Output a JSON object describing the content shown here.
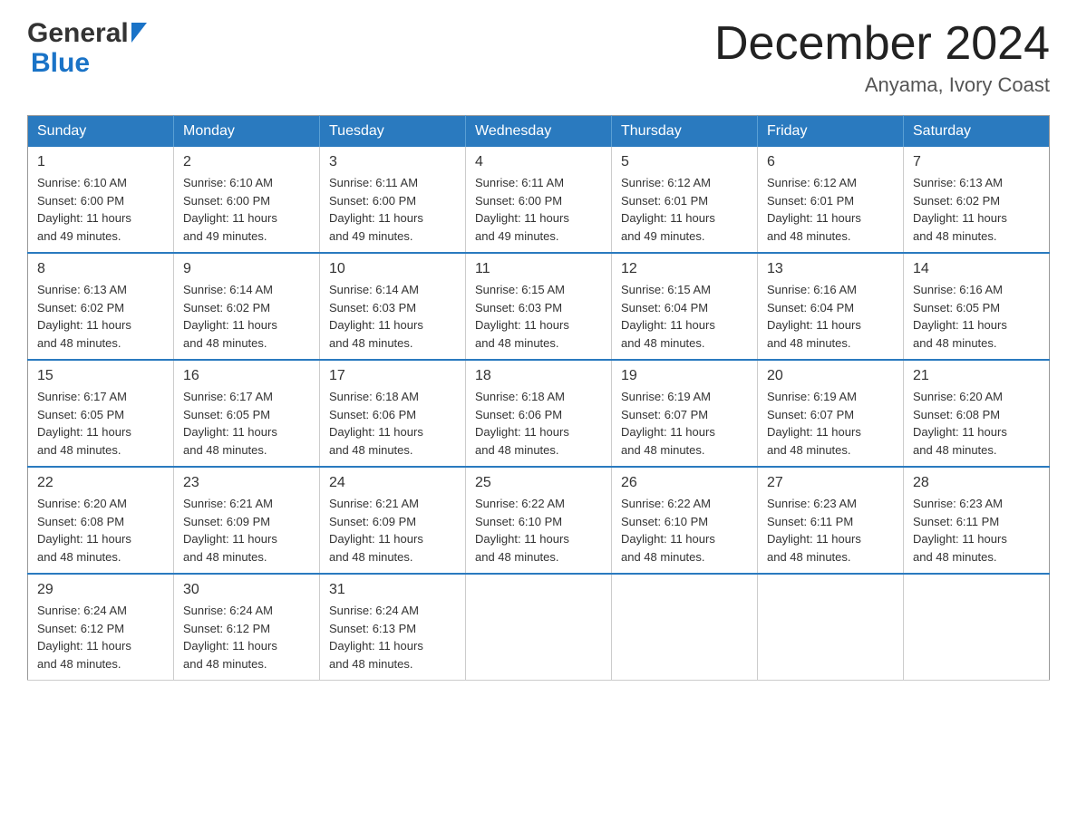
{
  "header": {
    "logo_general": "General",
    "logo_blue": "Blue",
    "month_title": "December 2024",
    "subtitle": "Anyama, Ivory Coast"
  },
  "calendar": {
    "days_of_week": [
      "Sunday",
      "Monday",
      "Tuesday",
      "Wednesday",
      "Thursday",
      "Friday",
      "Saturday"
    ],
    "weeks": [
      [
        {
          "day": "1",
          "sunrise": "6:10 AM",
          "sunset": "6:00 PM",
          "daylight": "11 hours and 49 minutes."
        },
        {
          "day": "2",
          "sunrise": "6:10 AM",
          "sunset": "6:00 PM",
          "daylight": "11 hours and 49 minutes."
        },
        {
          "day": "3",
          "sunrise": "6:11 AM",
          "sunset": "6:00 PM",
          "daylight": "11 hours and 49 minutes."
        },
        {
          "day": "4",
          "sunrise": "6:11 AM",
          "sunset": "6:00 PM",
          "daylight": "11 hours and 49 minutes."
        },
        {
          "day": "5",
          "sunrise": "6:12 AM",
          "sunset": "6:01 PM",
          "daylight": "11 hours and 49 minutes."
        },
        {
          "day": "6",
          "sunrise": "6:12 AM",
          "sunset": "6:01 PM",
          "daylight": "11 hours and 48 minutes."
        },
        {
          "day": "7",
          "sunrise": "6:13 AM",
          "sunset": "6:02 PM",
          "daylight": "11 hours and 48 minutes."
        }
      ],
      [
        {
          "day": "8",
          "sunrise": "6:13 AM",
          "sunset": "6:02 PM",
          "daylight": "11 hours and 48 minutes."
        },
        {
          "day": "9",
          "sunrise": "6:14 AM",
          "sunset": "6:02 PM",
          "daylight": "11 hours and 48 minutes."
        },
        {
          "day": "10",
          "sunrise": "6:14 AM",
          "sunset": "6:03 PM",
          "daylight": "11 hours and 48 minutes."
        },
        {
          "day": "11",
          "sunrise": "6:15 AM",
          "sunset": "6:03 PM",
          "daylight": "11 hours and 48 minutes."
        },
        {
          "day": "12",
          "sunrise": "6:15 AM",
          "sunset": "6:04 PM",
          "daylight": "11 hours and 48 minutes."
        },
        {
          "day": "13",
          "sunrise": "6:16 AM",
          "sunset": "6:04 PM",
          "daylight": "11 hours and 48 minutes."
        },
        {
          "day": "14",
          "sunrise": "6:16 AM",
          "sunset": "6:05 PM",
          "daylight": "11 hours and 48 minutes."
        }
      ],
      [
        {
          "day": "15",
          "sunrise": "6:17 AM",
          "sunset": "6:05 PM",
          "daylight": "11 hours and 48 minutes."
        },
        {
          "day": "16",
          "sunrise": "6:17 AM",
          "sunset": "6:05 PM",
          "daylight": "11 hours and 48 minutes."
        },
        {
          "day": "17",
          "sunrise": "6:18 AM",
          "sunset": "6:06 PM",
          "daylight": "11 hours and 48 minutes."
        },
        {
          "day": "18",
          "sunrise": "6:18 AM",
          "sunset": "6:06 PM",
          "daylight": "11 hours and 48 minutes."
        },
        {
          "day": "19",
          "sunrise": "6:19 AM",
          "sunset": "6:07 PM",
          "daylight": "11 hours and 48 minutes."
        },
        {
          "day": "20",
          "sunrise": "6:19 AM",
          "sunset": "6:07 PM",
          "daylight": "11 hours and 48 minutes."
        },
        {
          "day": "21",
          "sunrise": "6:20 AM",
          "sunset": "6:08 PM",
          "daylight": "11 hours and 48 minutes."
        }
      ],
      [
        {
          "day": "22",
          "sunrise": "6:20 AM",
          "sunset": "6:08 PM",
          "daylight": "11 hours and 48 minutes."
        },
        {
          "day": "23",
          "sunrise": "6:21 AM",
          "sunset": "6:09 PM",
          "daylight": "11 hours and 48 minutes."
        },
        {
          "day": "24",
          "sunrise": "6:21 AM",
          "sunset": "6:09 PM",
          "daylight": "11 hours and 48 minutes."
        },
        {
          "day": "25",
          "sunrise": "6:22 AM",
          "sunset": "6:10 PM",
          "daylight": "11 hours and 48 minutes."
        },
        {
          "day": "26",
          "sunrise": "6:22 AM",
          "sunset": "6:10 PM",
          "daylight": "11 hours and 48 minutes."
        },
        {
          "day": "27",
          "sunrise": "6:23 AM",
          "sunset": "6:11 PM",
          "daylight": "11 hours and 48 minutes."
        },
        {
          "day": "28",
          "sunrise": "6:23 AM",
          "sunset": "6:11 PM",
          "daylight": "11 hours and 48 minutes."
        }
      ],
      [
        {
          "day": "29",
          "sunrise": "6:24 AM",
          "sunset": "6:12 PM",
          "daylight": "11 hours and 48 minutes."
        },
        {
          "day": "30",
          "sunrise": "6:24 AM",
          "sunset": "6:12 PM",
          "daylight": "11 hours and 48 minutes."
        },
        {
          "day": "31",
          "sunrise": "6:24 AM",
          "sunset": "6:13 PM",
          "daylight": "11 hours and 48 minutes."
        },
        null,
        null,
        null,
        null
      ]
    ],
    "labels": {
      "sunrise": "Sunrise:",
      "sunset": "Sunset:",
      "daylight": "Daylight:"
    }
  }
}
